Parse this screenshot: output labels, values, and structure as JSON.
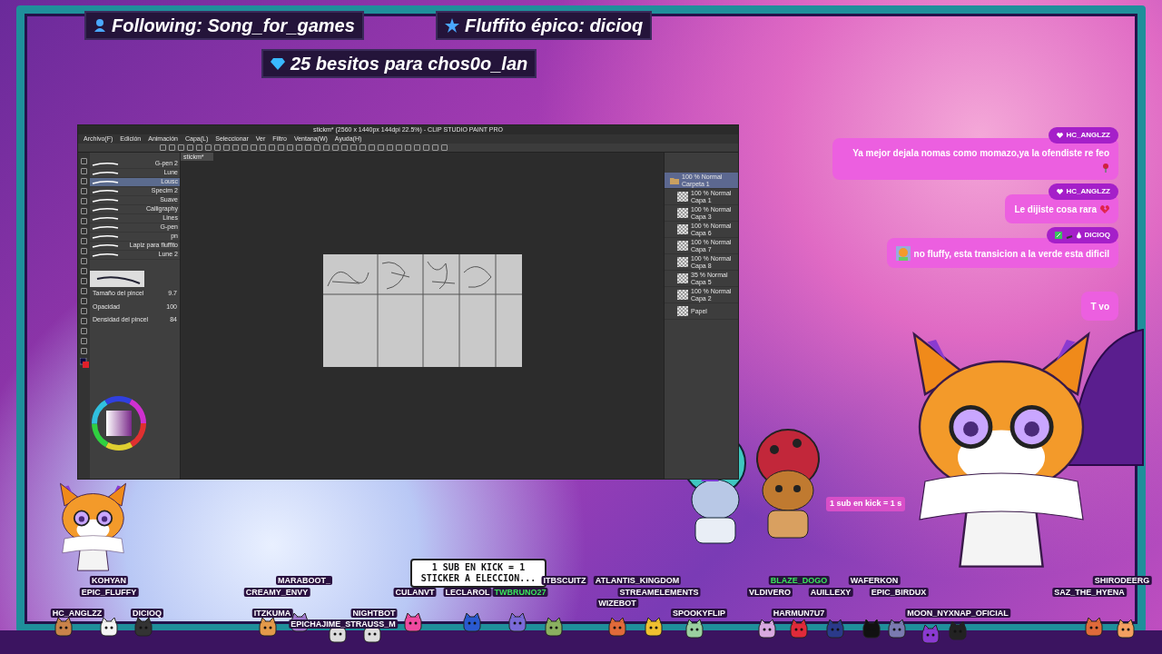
{
  "alerts": [
    {
      "kind": "follow",
      "text": "Following: Song_for_games"
    },
    {
      "kind": "star",
      "text": "Fluffito épico: dicioq"
    },
    {
      "kind": "gem",
      "text": "25 besitos para chos0o_lan"
    }
  ],
  "paint_window": {
    "title": "stickm* (2560 x 1440px 144dpi 22.5%) - CLIP STUDIO PAINT PRO",
    "menu": [
      "Archivo(F)",
      "Edición",
      "Animación",
      "Capa(L)",
      "Seleccionar",
      "Ver",
      "Filtro",
      "Ventana(W)",
      "Ayuda(H)"
    ],
    "tab": "stickm*",
    "brushes": [
      {
        "name": "G-pen 2",
        "selected": false
      },
      {
        "name": "Lune",
        "selected": false
      },
      {
        "name": "Lousc",
        "selected": true
      },
      {
        "name": "Specim 2",
        "selected": false
      },
      {
        "name": "Suave",
        "selected": false
      },
      {
        "name": "Calligraphy",
        "selected": false
      },
      {
        "name": "Lines",
        "selected": false
      },
      {
        "name": "G-pen",
        "selected": false
      },
      {
        "name": "pn",
        "selected": false
      },
      {
        "name": "Lapiz para fluffito",
        "selected": false
      },
      {
        "name": "Lune 2",
        "selected": false
      }
    ],
    "brush_settings": [
      {
        "label": "Tamaño del pincel",
        "value": "9.7"
      },
      {
        "label": "Opacidad",
        "value": "100"
      },
      {
        "label": "Densidad del pincel",
        "value": "84"
      }
    ],
    "layers": [
      {
        "blend": "100 % Normal",
        "name": "Carpeta 1",
        "selected": true,
        "folder": true
      },
      {
        "blend": "100 % Normal",
        "name": "Capa 1",
        "selected": false,
        "folder": false
      },
      {
        "blend": "100 % Normal",
        "name": "Capa 3",
        "selected": false,
        "folder": false
      },
      {
        "blend": "100 % Normal",
        "name": "Capa 6",
        "selected": false,
        "folder": false
      },
      {
        "blend": "100 % Normal",
        "name": "Capa 7",
        "selected": false,
        "folder": false
      },
      {
        "blend": "100 % Normal",
        "name": "Capa 8",
        "selected": false,
        "folder": false
      },
      {
        "blend": "35 % Normal",
        "name": "Capa 5",
        "selected": false,
        "folder": false
      },
      {
        "blend": "100 % Normal",
        "name": "Capa 2",
        "selected": false,
        "folder": false
      },
      {
        "name": "Papel",
        "selected": false,
        "folder": false
      }
    ]
  },
  "chat": [
    {
      "user": "HC_ANGLZZ",
      "badges": [
        {
          "kind": "heart"
        }
      ],
      "text": "Ya mejor dejala nomas como momazo,ya la ofendiste re feo",
      "emote": {
        "kind": "rose"
      }
    },
    {
      "user": "HC_ANGLZZ",
      "badges": [
        {
          "kind": "heart"
        }
      ],
      "text": "Le dijiste cosa rara",
      "emote": {
        "kind": "broken-heart"
      }
    },
    {
      "user": "DICIOQ",
      "badges": [
        {
          "kind": "pencil"
        },
        {
          "kind": "sword"
        },
        {
          "kind": "drop"
        }
      ],
      "text": "no fluffy, esta transicion a la verde esta dificil",
      "emote": {
        "kind": "avatar"
      }
    },
    {
      "text": "T vo"
    }
  ],
  "ticker": "1 sub en kick = 1 s",
  "sticker_box": "1 SUB EN KICK = 1 STICKER A ELECCION...",
  "viewers": [
    {
      "name": "KOHYAN",
      "highlighted": false
    },
    {
      "name": "MARABOOT_",
      "highlighted": false
    },
    {
      "name": "ITBSCUITZ",
      "highlighted": false
    },
    {
      "name": "ATLANTIS_KINGDOM",
      "highlighted": false
    },
    {
      "name": "BLAZE_DOGO",
      "highlighted": true
    },
    {
      "name": "WAFERKON",
      "highlighted": false
    },
    {
      "name": "SHIRODEERG",
      "highlighted": false
    },
    {
      "name": "EPIC_FLUFFY",
      "highlighted": false
    },
    {
      "name": "CREAMY_ENVY",
      "highlighted": false
    },
    {
      "name": "CULANVT",
      "highlighted": false
    },
    {
      "name": "LECLAROL",
      "highlighted": false
    },
    {
      "name": "TWBRUNO27",
      "highlighted": true
    },
    {
      "name": "STREAMELEMENTS",
      "highlighted": false
    },
    {
      "name": "VLDIVERO",
      "highlighted": false
    },
    {
      "name": "AUILLEXY",
      "highlighted": false
    },
    {
      "name": "EPIC_BIRDUX",
      "highlighted": false
    },
    {
      "name": "SAZ_THE_HYENA",
      "highlighted": false
    },
    {
      "name": "WIZEBOT",
      "highlighted": false
    },
    {
      "name": "HC_ANGLZZ",
      "highlighted": false
    },
    {
      "name": "DICIOQ",
      "highlighted": false
    },
    {
      "name": "ITZKUMA",
      "highlighted": false
    },
    {
      "name": "NIGHTBOT",
      "highlighted": false
    },
    {
      "name": "SPOOKYFLIP",
      "highlighted": false
    },
    {
      "name": "HARMUN7U7",
      "highlighted": false
    },
    {
      "name": "MOON_NYXNAP_OFICIAL",
      "highlighted": false
    },
    {
      "name": "EPICHAJIME_STRAUSS_M",
      "highlighted": false
    }
  ]
}
